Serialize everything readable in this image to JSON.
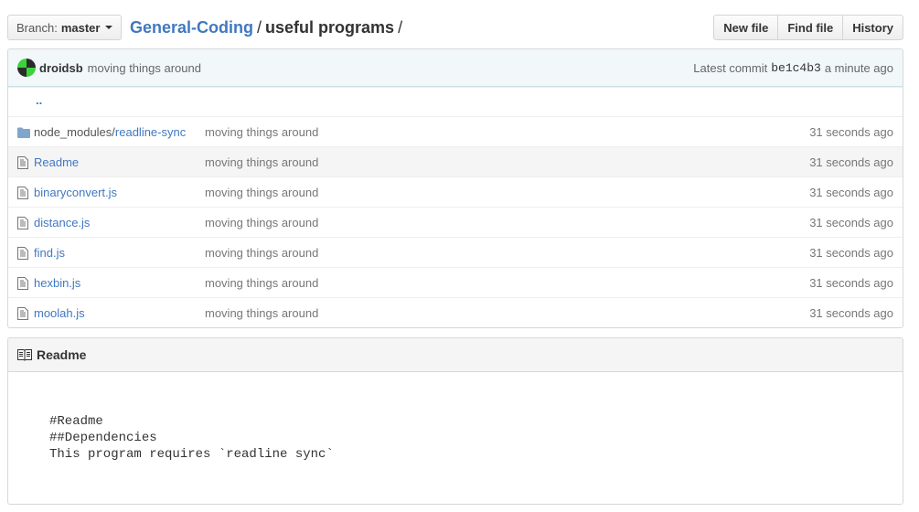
{
  "branch": {
    "label": "Branch:",
    "name": "master"
  },
  "breadcrumb": {
    "repo": "General-Coding",
    "separator": "/",
    "dir": "useful programs",
    "trailing": "/"
  },
  "actions": {
    "new_file": "New file",
    "find_file": "Find file",
    "history": "History"
  },
  "commit": {
    "author": "droidsb",
    "message": "moving things around",
    "latest_label": "Latest commit",
    "sha": "be1c4b3",
    "age": "a minute ago"
  },
  "up_dir": "..",
  "files": [
    {
      "type": "folder",
      "prefix": "node_modules/",
      "name": "readline-sync",
      "message": "moving things around",
      "age": "31 seconds ago"
    },
    {
      "type": "file",
      "prefix": "",
      "name": "Readme",
      "message": "moving things around",
      "age": "31 seconds ago"
    },
    {
      "type": "file",
      "prefix": "",
      "name": "binaryconvert.js",
      "message": "moving things around",
      "age": "31 seconds ago"
    },
    {
      "type": "file",
      "prefix": "",
      "name": "distance.js",
      "message": "moving things around",
      "age": "31 seconds ago"
    },
    {
      "type": "file",
      "prefix": "",
      "name": "find.js",
      "message": "moving things around",
      "age": "31 seconds ago"
    },
    {
      "type": "file",
      "prefix": "",
      "name": "hexbin.js",
      "message": "moving things around",
      "age": "31 seconds ago"
    },
    {
      "type": "file",
      "prefix": "",
      "name": "moolah.js",
      "message": "moving things around",
      "age": "31 seconds ago"
    }
  ],
  "readme": {
    "title": "Readme",
    "content": "#Readme\n##Dependencies\nThis program requires `readline sync`"
  },
  "colors": {
    "link": "#4078c0",
    "commit_bar": "#f2f8fa",
    "folder_icon": "#80a6cd"
  },
  "icons": {
    "folder": "folder-icon",
    "file": "file-icon",
    "book": "book-icon",
    "caret": "caret-down-icon"
  }
}
